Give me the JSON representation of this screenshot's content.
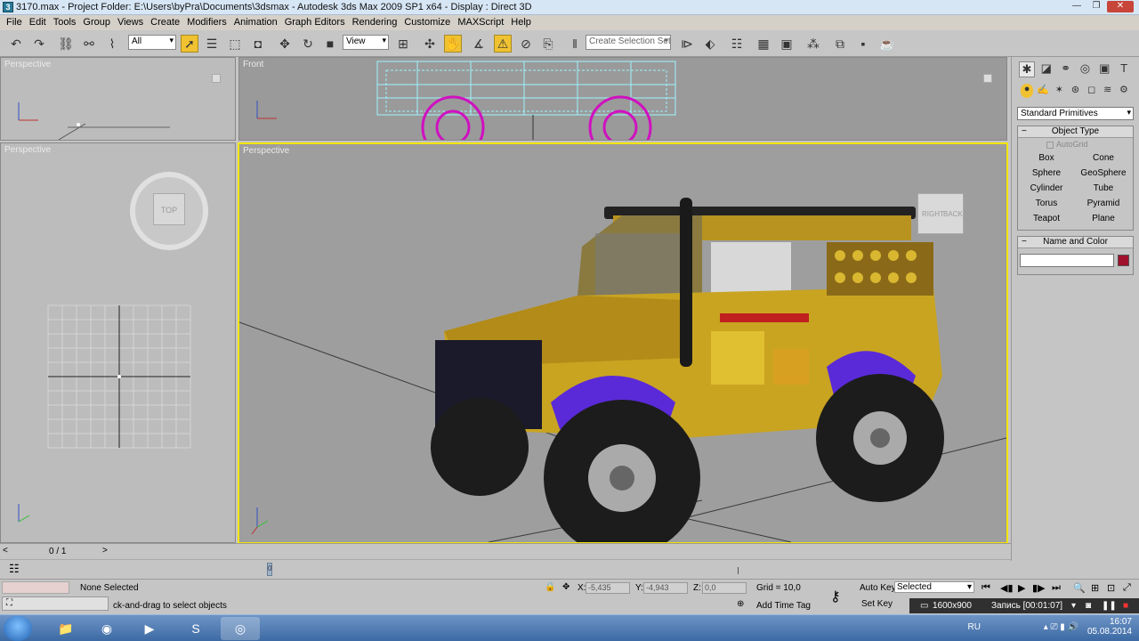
{
  "window": {
    "icon": "3ds-max-icon",
    "title": "3170.max      - Project Folder: E:\\Users\\byPra\\Documents\\3dsmax      - Autodesk 3ds Max  2009 SP1  x64      - Display : Direct 3D",
    "minimize": "—",
    "restore": "❐",
    "close": "✕"
  },
  "menu": [
    "File",
    "Edit",
    "Tools",
    "Group",
    "Views",
    "Create",
    "Modifiers",
    "Animation",
    "Graph Editors",
    "Rendering",
    "Customize",
    "MAXScript",
    "Help"
  ],
  "toolbar": {
    "selection_filter": "All",
    "ref_coord": "View",
    "named_selection_placeholder": "Create Selection Set"
  },
  "viewports": {
    "top_left_label": "Perspective",
    "front_label": "Front",
    "left_label": "Perspective",
    "main_label": "Perspective",
    "viewcube_top": "TOP",
    "viewcube_right": "RIGHT",
    "viewcube_back": "BACK"
  },
  "command_panel": {
    "category_dropdown": "Standard Primitives",
    "object_type_title": "Object Type",
    "autogrid": "AutoGrid",
    "buttons": [
      "Box",
      "Cone",
      "Sphere",
      "GeoSphere",
      "Cylinder",
      "Tube",
      "Torus",
      "Pyramid",
      "Teapot",
      "Plane"
    ],
    "name_color_title": "Name and Color",
    "object_color": "#a0102a"
  },
  "timeline": {
    "frame_counter": "0 / 1",
    "prev": "<",
    "next": ">",
    "key_marker": "0"
  },
  "status": {
    "selection": "None Selected",
    "prompt": "ck-and-drag to select objects",
    "x_label": "X:",
    "x_value": "-5,435",
    "y_label": "Y:",
    "y_value": "-4,943",
    "z_label": "Z:",
    "z_value": "0,0",
    "grid": "Grid = 10,0",
    "add_time_tag": "Add Time Tag",
    "auto_key": "Auto Key",
    "set_key": "Set Key",
    "key_mode": "Selected",
    "resolution": "1600x900",
    "recording": "Запись [00:01:07]"
  },
  "taskbar": {
    "lang": "RU",
    "time": "16:07",
    "date": "05.08.2014"
  }
}
